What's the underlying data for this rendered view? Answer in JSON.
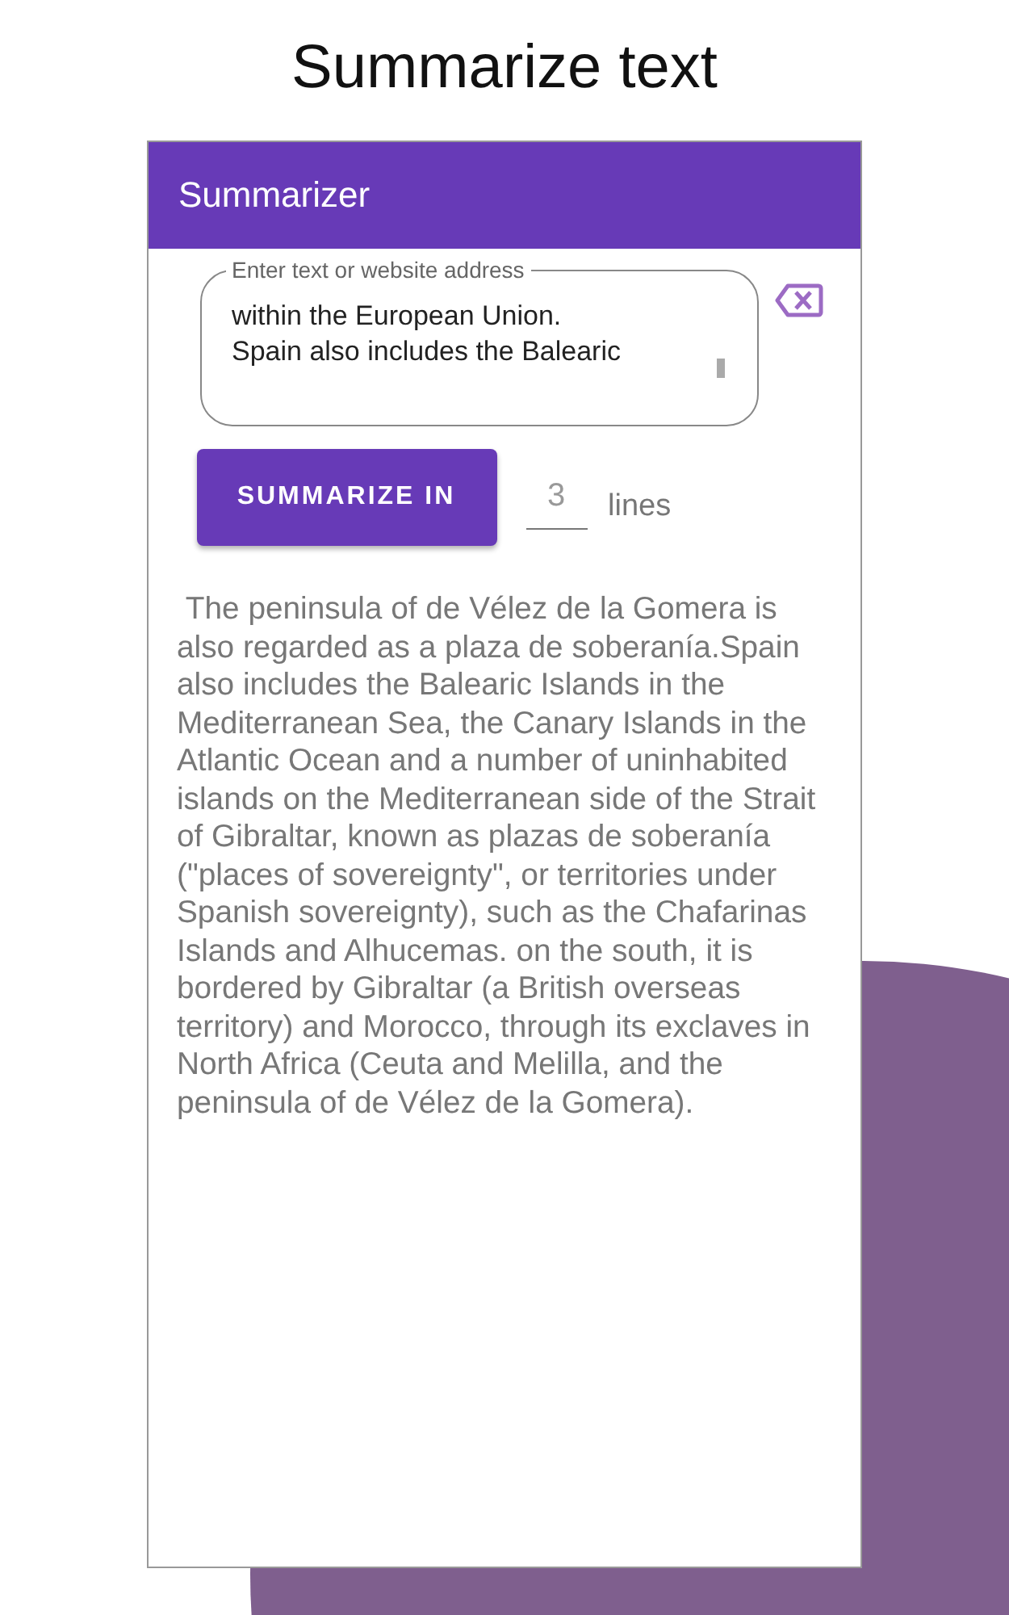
{
  "page_title": "Summarize text",
  "app_bar": {
    "title": "Summarizer"
  },
  "input": {
    "label": "Enter text or website address",
    "value": "within the European Union.\nSpain also includes the Balearic"
  },
  "summarize_button": "SUMMARIZE IN",
  "lines_field": {
    "value": "3",
    "unit": "lines"
  },
  "summary": " The peninsula of de Vélez de la Gomera is also regarded as a plaza de soberanía.Spain also includes the Balearic Islands in the Mediterranean Sea, the Canary Islands in the Atlantic Ocean and a number of uninhabited islands on the Mediterranean side of the Strait of Gibraltar, known as plazas de soberanía (\"places of sovereignty\", or territories under Spanish sovereignty), such as the Chafarinas Islands and Alhucemas. on the south, it is bordered by Gibraltar (a British overseas territory) and Morocco, through its exclaves in North Africa (Ceuta and Melilla, and the peninsula of de Vélez de la Gomera)."
}
